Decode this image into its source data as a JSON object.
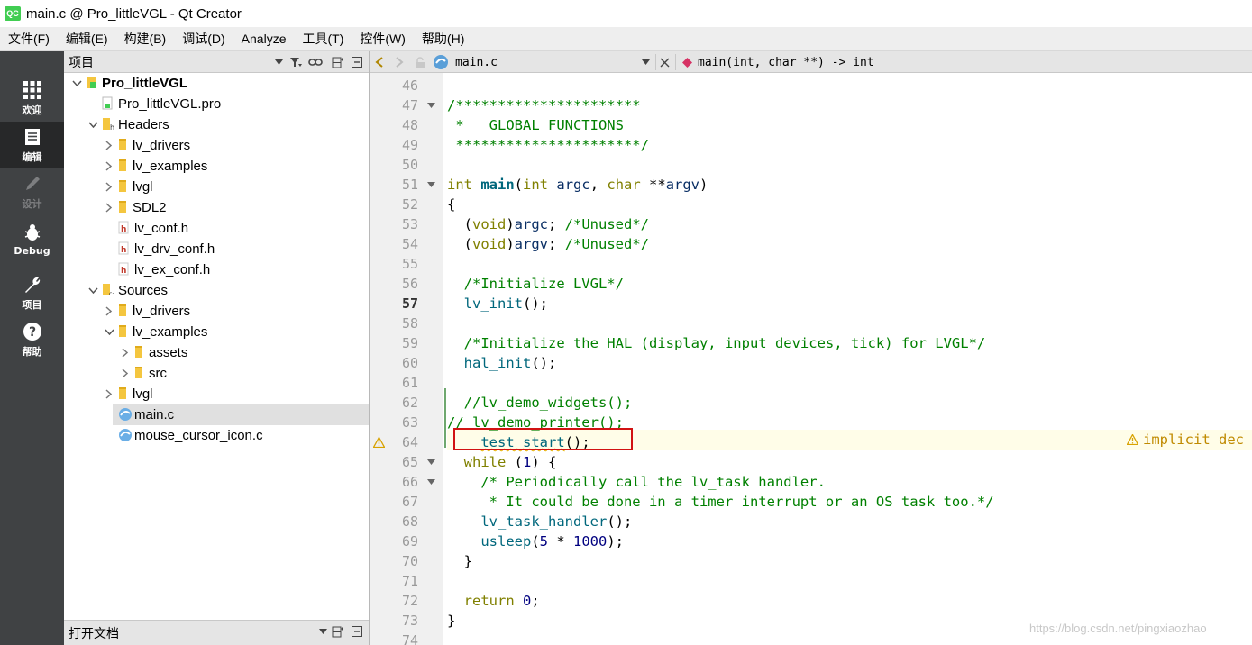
{
  "window": {
    "logo_text": "QC",
    "title": "main.c @ Pro_littleVGL - Qt Creator"
  },
  "menu": [
    "文件(F)",
    "编辑(E)",
    "构建(B)",
    "调试(D)",
    "Analyze",
    "工具(T)",
    "控件(W)",
    "帮助(H)"
  ],
  "modes": [
    {
      "label": "欢迎",
      "icon": "welcome-grid-icon"
    },
    {
      "label": "编辑",
      "icon": "edit-document-icon"
    },
    {
      "label": "设计",
      "icon": "design-pencil-icon"
    },
    {
      "label": "Debug",
      "icon": "debug-bug-icon"
    },
    {
      "label": "项目",
      "icon": "projects-wrench-icon"
    },
    {
      "label": "帮助",
      "icon": "help-question-icon"
    }
  ],
  "project_panel": {
    "title": "项目"
  },
  "tree": [
    {
      "label": "Pro_littleVGL",
      "icon": "project-icon",
      "expanded": true
    },
    {
      "label": "Pro_littleVGL.pro",
      "icon": "pro-file-icon"
    },
    {
      "label": "Headers",
      "icon": "headers-folder-icon",
      "expanded": true
    },
    {
      "label": "lv_drivers",
      "icon": "folder-icon",
      "expanded": false
    },
    {
      "label": "lv_examples",
      "icon": "folder-icon",
      "expanded": false
    },
    {
      "label": "lvgl",
      "icon": "folder-icon",
      "expanded": false
    },
    {
      "label": "SDL2",
      "icon": "folder-icon",
      "expanded": false
    },
    {
      "label": "lv_conf.h",
      "icon": "header-file-icon"
    },
    {
      "label": "lv_drv_conf.h",
      "icon": "header-file-icon"
    },
    {
      "label": "lv_ex_conf.h",
      "icon": "header-file-icon"
    },
    {
      "label": "Sources",
      "icon": "sources-folder-icon",
      "expanded": true
    },
    {
      "label": "lv_drivers",
      "icon": "folder-icon",
      "expanded": false
    },
    {
      "label": "lv_examples",
      "icon": "folder-icon",
      "expanded": true
    },
    {
      "label": "assets",
      "icon": "folder-icon",
      "expanded": false
    },
    {
      "label": "src",
      "icon": "folder-icon",
      "expanded": false
    },
    {
      "label": "lvgl",
      "icon": "folder-icon",
      "expanded": false
    },
    {
      "label": "main.c",
      "icon": "c-file-icon",
      "selected": true
    },
    {
      "label": "mouse_cursor_icon.c",
      "icon": "c-file-icon"
    }
  ],
  "open_docs": {
    "title": "打开文档"
  },
  "editor_toolbar": {
    "file": "main.c",
    "function": "main(int, char **) -> int"
  },
  "editor": {
    "line_numbers": [
      "46",
      "47",
      "48",
      "49",
      "50",
      "51",
      "52",
      "53",
      "54",
      "55",
      "56",
      "57",
      "58",
      "59",
      "60",
      "61",
      "62",
      "63",
      "64",
      "65",
      "66",
      "67",
      "68",
      "69",
      "70",
      "71",
      "72",
      "73",
      "74"
    ],
    "current_line": "57",
    "warning_line": "64",
    "warning_text": "implicit dec",
    "lines": [
      "",
      "/**********************",
      " *   GLOBAL FUNCTIONS",
      " **********************/",
      "",
      "int main(int argc, char **argv)",
      "{",
      "  (void)argc; /*Unused*/",
      "  (void)argv; /*Unused*/",
      "",
      "  /*Initialize LVGL*/",
      "  lv_init();",
      "",
      "  /*Initialize the HAL (display, input devices, tick) for LVGL*/",
      "  hal_init();",
      "",
      "  //lv_demo_widgets();",
      "// lv_demo_printer();",
      "    test_start();",
      "  while (1) {",
      "    /* Periodically call the lv_task handler.",
      "     * It could be done in a timer interrupt or an OS task too.*/",
      "    lv_task_handler();",
      "    usleep(5 * 1000);",
      "  }",
      "",
      "  return 0;",
      "}",
      ""
    ]
  },
  "watermark": "https://blog.csdn.net/pingxiaozhao"
}
